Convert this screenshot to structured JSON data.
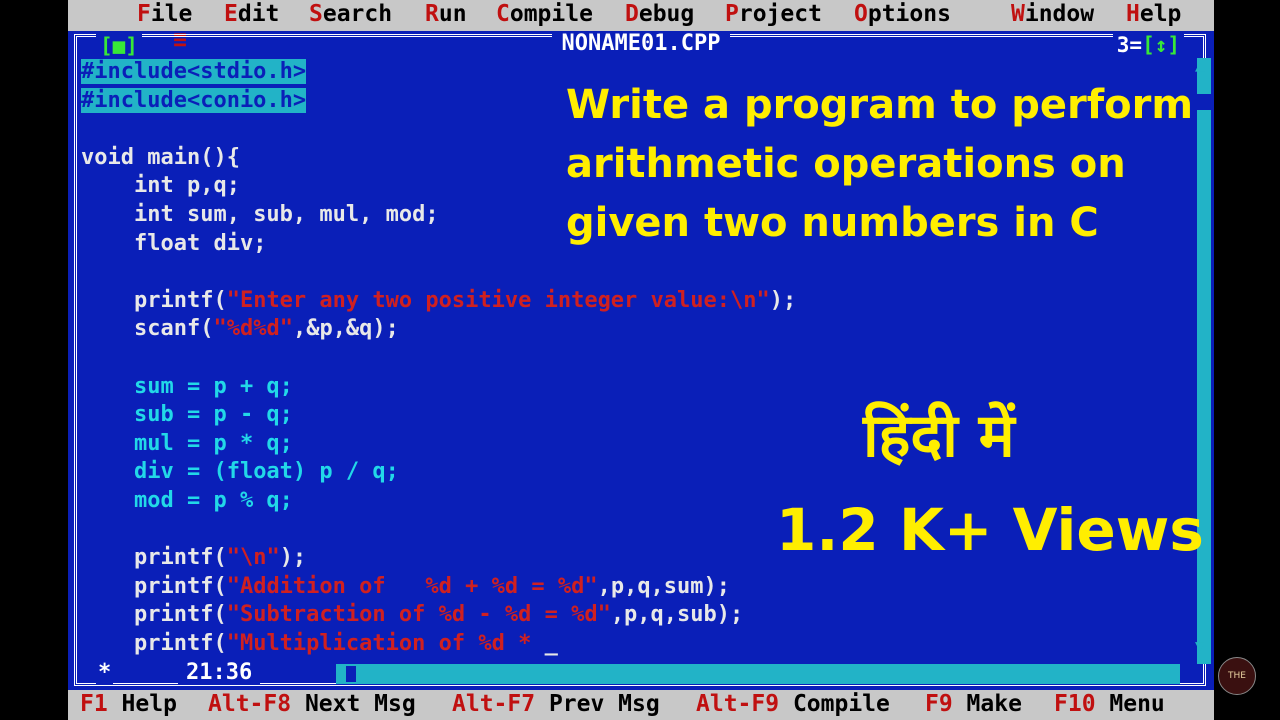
{
  "menu": {
    "system": "≡",
    "items": [
      {
        "hot": "F",
        "rest": "ile"
      },
      {
        "hot": "E",
        "rest": "dit"
      },
      {
        "hot": "S",
        "rest": "earch"
      },
      {
        "hot": "R",
        "rest": "un"
      },
      {
        "hot": "C",
        "rest": "ompile"
      },
      {
        "hot": "D",
        "rest": "ebug"
      },
      {
        "hot": "P",
        "rest": "roject"
      },
      {
        "hot": "O",
        "rest": "ptions"
      },
      {
        "hot": "W",
        "rest": "indow"
      },
      {
        "hot": "H",
        "rest": "elp"
      }
    ]
  },
  "window": {
    "title": "NONAME01.CPP",
    "close": "[■]",
    "number": "3",
    "zoom": "[↕]"
  },
  "code": {
    "include1": "#include<stdio.h>",
    "include2": "#include<conio.h>",
    "main_sig": "void main(){",
    "decl1": "int p,q;",
    "decl2": "int sum, sub, mul, mod;",
    "decl3": "float div;",
    "printf1_fn": "printf(",
    "printf1_str": "\"Enter any two positive integer value:\\n\"",
    "printf1_end": ");",
    "scanf_fn": "scanf(",
    "scanf_str": "\"%d%d\"",
    "scanf_end": ",&p,&q);",
    "sum": "sum = p + q;",
    "sub": "sub = p - q;",
    "mul": "mul = p * q;",
    "div": "div = (float) p / q;",
    "mod": "mod = p % q;",
    "printf2_fn": "printf(",
    "printf2_str": "\"\\n\"",
    "printf2_end": ");",
    "printf3_fn": "printf(",
    "printf3_str": "\"Addition of   %d + %d = %d\"",
    "printf3_end": ",p,q,sum);",
    "printf4_fn": "printf(",
    "printf4_str": "\"Subtraction of %d - %d = %d\"",
    "printf4_end": ",p,q,sub);",
    "printf5_fn": "printf(",
    "printf5_str": "\"Multiplication of %d * ",
    "cursor": "_"
  },
  "overlay": {
    "title_line1": "Write a program to perform",
    "title_line2": "arithmetic operations on",
    "title_line3": "given two numbers in C",
    "hindi": "हिंदी में",
    "views": "1.2 K+ Views"
  },
  "status": {
    "star": "*",
    "position": "21:36"
  },
  "hotkeys": [
    {
      "key": "F1",
      "label": " Help"
    },
    {
      "key": "Alt-F8",
      "label": " Next Msg"
    },
    {
      "key": "Alt-F7",
      "label": " Prev Msg"
    },
    {
      "key": "Alt-F9",
      "label": " Compile"
    },
    {
      "key": "F9",
      "label": " Make"
    },
    {
      "key": "F10",
      "label": " Menu"
    }
  ],
  "colors": {
    "editor_bg": "#0a1fb8",
    "menu_bg": "#c8c8c8",
    "hotkey": "#c01010",
    "overlay_text": "#ffee00",
    "string": "#d02020",
    "variable": "#22d8e8"
  }
}
